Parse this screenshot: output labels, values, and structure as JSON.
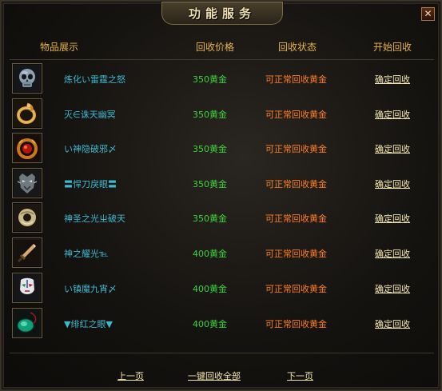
{
  "window": {
    "title": "功能服务",
    "close_glyph": "✕"
  },
  "header": {
    "item_col": "物品展示",
    "price_col": "回收价格",
    "status_col": "回收状态",
    "action_col": "开始回收"
  },
  "items": [
    {
      "name": "炼化い雷霆之怒",
      "price": "350黄金",
      "status": "可正常回收黄金",
      "action": "确定回收",
      "icon": "skull-icon"
    },
    {
      "name": "灭∈诛天幽冥",
      "price": "350黄金",
      "status": "可正常回收黄金",
      "action": "确定回收",
      "icon": "golden-ring-icon"
    },
    {
      "name": "い神隐破邪〆",
      "price": "350黄金",
      "status": "可正常回收黄金",
      "action": "确定回收",
      "icon": "red-gem-ring-icon"
    },
    {
      "name": "〓悍刀戾眼〓",
      "price": "350黄金",
      "status": "可正常回收黄金",
      "action": "确定回收",
      "icon": "demon-mask-icon"
    },
    {
      "name": "神圣之光ㄓ破天",
      "price": "350黄金",
      "status": "可正常回收黄金",
      "action": "确定回收",
      "icon": "jade-bracelet-icon"
    },
    {
      "name": "神之耀光℡",
      "price": "400黄金",
      "status": "可正常回收黄金",
      "action": "确定回收",
      "icon": "dagger-icon"
    },
    {
      "name": "い镇魔九宵〆",
      "price": "400黄金",
      "status": "可正常回收黄金",
      "action": "确定回收",
      "icon": "opera-mask-icon"
    },
    {
      "name": "▼绯红之眼▼",
      "price": "400黄金",
      "status": "可正常回收黄金",
      "action": "确定回收",
      "icon": "emerald-pendant-icon"
    }
  ],
  "footer": {
    "prev": "上一页",
    "recycle_all": "一键回收全部",
    "next": "下一页"
  }
}
